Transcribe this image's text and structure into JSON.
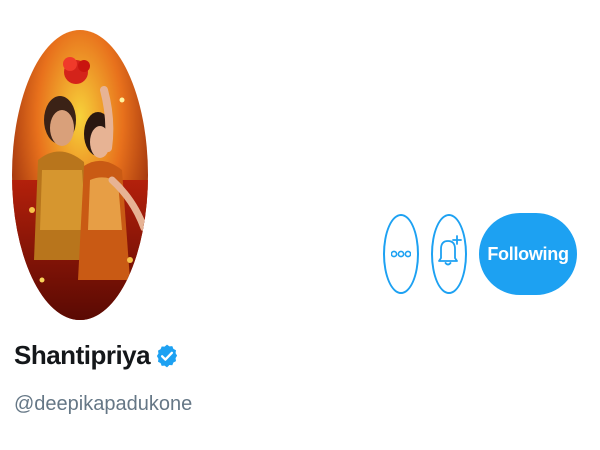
{
  "profile": {
    "display_name": "Shantipriya",
    "handle": "@deepikapadukone",
    "verified": true
  },
  "actions": {
    "more_icon": "more-dots-icon",
    "notify_icon": "bell-plus-icon",
    "following_label": "Following"
  },
  "colors": {
    "accent": "#1da1f2",
    "name_text": "#14171a",
    "handle_text": "#657786"
  }
}
